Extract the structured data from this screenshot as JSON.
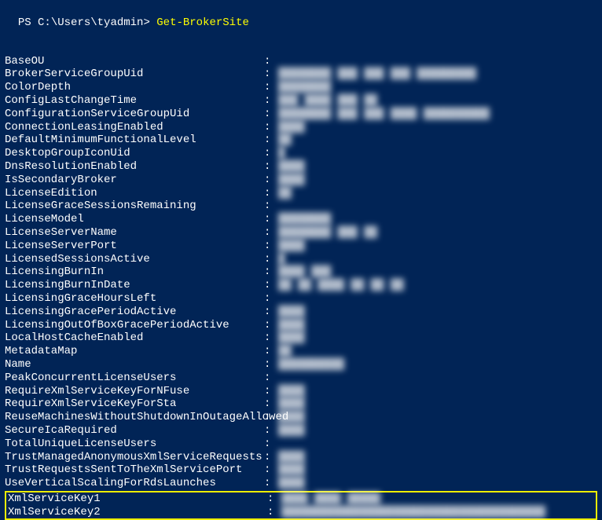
{
  "prompt": {
    "prefix": "PS ",
    "path": "C:\\Users\\tyadmin",
    "arrow": "> ",
    "command": "Get-BrokerSite"
  },
  "properties": [
    {
      "name": "BaseOU",
      "value": ""
    },
    {
      "name": "BrokerServiceGroupUid",
      "value": "████████ ███ ███ ███ █████████"
    },
    {
      "name": "ColorDepth",
      "value": "████████"
    },
    {
      "name": "ConfigLastChangeTime",
      "value": "███ ████ ███ ██"
    },
    {
      "name": "ConfigurationServiceGroupUid",
      "value": "████████ ███ ███ ████ ██████████"
    },
    {
      "name": "ConnectionLeasingEnabled",
      "value": "████"
    },
    {
      "name": "DefaultMinimumFunctionalLevel",
      "value": "██"
    },
    {
      "name": "DesktopGroupIconUid",
      "value": "█"
    },
    {
      "name": "DnsResolutionEnabled",
      "value": "████"
    },
    {
      "name": "IsSecondaryBroker",
      "value": "████"
    },
    {
      "name": "LicenseEdition",
      "value": "██"
    },
    {
      "name": "LicenseGraceSessionsRemaining",
      "value": ""
    },
    {
      "name": "LicenseModel",
      "value": "████████"
    },
    {
      "name": "LicenseServerName",
      "value": "████████ ███ ██"
    },
    {
      "name": "LicenseServerPort",
      "value": "████"
    },
    {
      "name": "LicensedSessionsActive",
      "value": "█"
    },
    {
      "name": "LicensingBurnIn",
      "value": "████ ███"
    },
    {
      "name": "LicensingBurnInDate",
      "value": "██ ██ ████ ██ ██ ██"
    },
    {
      "name": "LicensingGraceHoursLeft",
      "value": ""
    },
    {
      "name": "LicensingGracePeriodActive",
      "value": "████"
    },
    {
      "name": "LicensingOutOfBoxGracePeriodActive",
      "value": "████"
    },
    {
      "name": "LocalHostCacheEnabled",
      "value": "████"
    },
    {
      "name": "MetadataMap",
      "value": "██"
    },
    {
      "name": "Name",
      "value": "██████████"
    },
    {
      "name": "PeakConcurrentLicenseUsers",
      "value": ""
    },
    {
      "name": "RequireXmlServiceKeyForNFuse",
      "value": "████"
    },
    {
      "name": "RequireXmlServiceKeyForSta",
      "value": "████"
    },
    {
      "name": "ReuseMachinesWithoutShutdownInOutageAllowed",
      "value": "████"
    },
    {
      "name": "SecureIcaRequired",
      "value": "████"
    },
    {
      "name": "TotalUniqueLicenseUsers",
      "value": ""
    },
    {
      "name": "TrustManagedAnonymousXmlServiceRequests",
      "value": "████"
    },
    {
      "name": "TrustRequestsSentToTheXmlServicePort",
      "value": "████"
    },
    {
      "name": "UseVerticalScalingForRdsLaunches",
      "value": "████"
    }
  ],
  "highlighted_properties": [
    {
      "name": "XmlServiceKey1",
      "value": "████ ████ █████"
    },
    {
      "name": "XmlServiceKey2",
      "value": "████████████████████████████████████████"
    }
  ]
}
